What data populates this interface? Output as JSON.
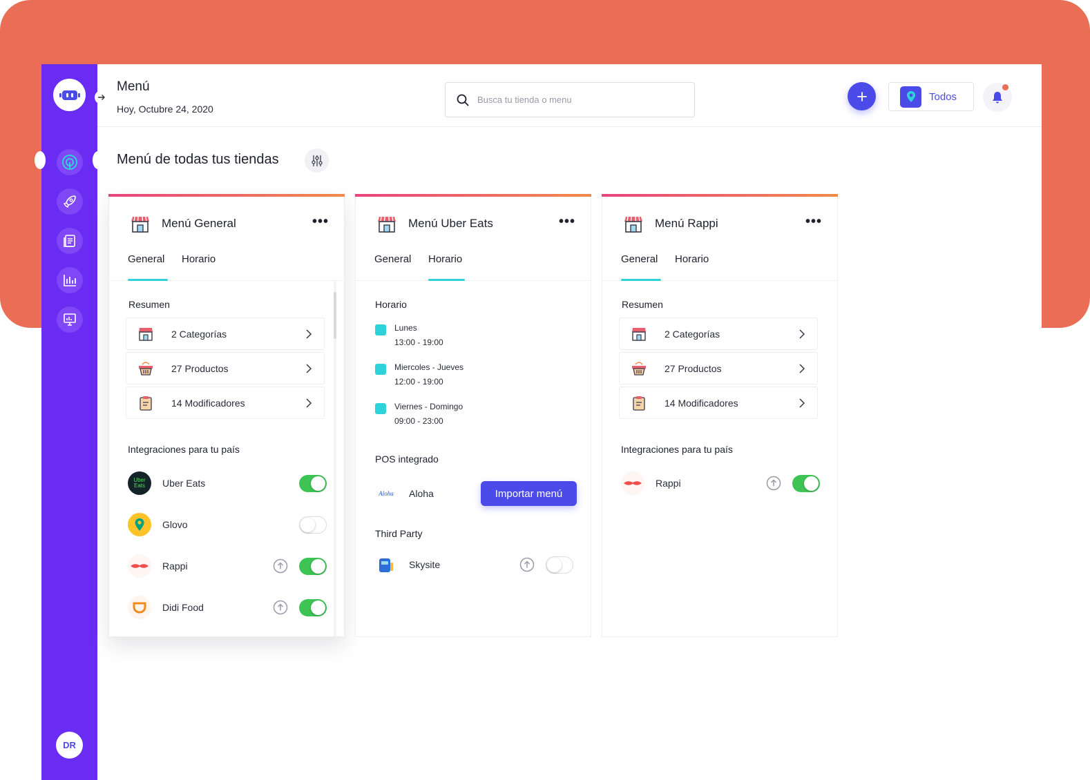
{
  "header": {
    "title": "Menú",
    "date": "Hoy, Octubre 24, 2020",
    "search_placeholder": "Busca tu tienda o menu",
    "store_filter_label": "Todos"
  },
  "sidebar": {
    "items": [
      "dashboard-icon",
      "rocket-icon",
      "menu-icon",
      "chart-icon",
      "presentation-icon"
    ],
    "active_index": 0,
    "avatar_initials": "DR"
  },
  "section": {
    "title": "Menú de todas tus tiendas"
  },
  "colors": {
    "sidebar": "#6A2BF3",
    "accent": "#4A4BE8",
    "teal": "#2ED3D9",
    "toggle_on": "#3DC454",
    "background_top": "#E96E55"
  },
  "cards": {
    "general": {
      "title": "Menú General",
      "tabs": [
        "General",
        "Horario"
      ],
      "active_tab": "General",
      "summary_title": "Resumen",
      "summary": [
        "2 Categorías",
        "27 Productos",
        "14 Modificadores"
      ],
      "integrations_title": "Integraciones para tu país",
      "integrations": [
        {
          "name": "Uber Eats",
          "logo_text": "Uber Eats",
          "on": true,
          "upload": false
        },
        {
          "name": "Glovo",
          "on": false,
          "upload": false
        },
        {
          "name": "Rappi",
          "on": true,
          "upload": true
        },
        {
          "name": "Didi Food",
          "on": true,
          "upload": true
        }
      ]
    },
    "uber": {
      "title": "Menú Uber Eats",
      "tabs": [
        "General",
        "Horario"
      ],
      "active_tab": "Horario",
      "schedule_title": "Horario",
      "schedule": [
        {
          "day": "Lunes",
          "time": "13:00 - 19:00"
        },
        {
          "day": "Miercoles - Jueves",
          "time": "12:00 - 19:00"
        },
        {
          "day": "Viernes - Domingo",
          "time": "09:00 - 23:00"
        }
      ],
      "pos_title": "POS integrado",
      "pos": {
        "name": "Aloha",
        "logo_text": "Aloha",
        "button_label": "Importar menú"
      },
      "third_party_title": "Third Party",
      "third_party": {
        "name": "Skysite",
        "on": false,
        "upload": true
      }
    },
    "rappi": {
      "title": "Menú Rappi",
      "tabs": [
        "General",
        "Horario"
      ],
      "active_tab": "General",
      "summary_title": "Resumen",
      "summary": [
        "2 Categorías",
        "27 Productos",
        "14 Modificadores"
      ],
      "integrations_title": "Integraciones para tu país",
      "integrations": [
        {
          "name": "Rappi",
          "on": true,
          "upload": true
        }
      ]
    }
  }
}
